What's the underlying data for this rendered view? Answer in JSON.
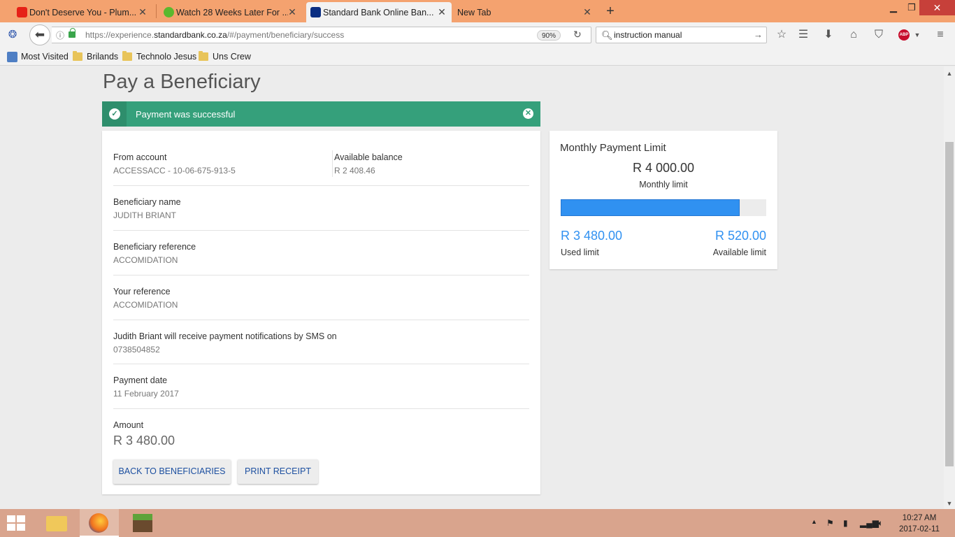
{
  "browser": {
    "tabs": [
      {
        "title": "Don't Deserve You - Plum...",
        "favicon": "youtube-icon",
        "color": "#e62117"
      },
      {
        "title": "Watch 28 Weeks Later For ...",
        "favicon": "play-icon",
        "color": "#5bb82e"
      },
      {
        "title": "Standard Bank Online Ban...",
        "favicon": "standard-bank-icon",
        "color": "#0a2e82"
      },
      {
        "title": "New Tab",
        "favicon": "",
        "color": ""
      }
    ],
    "url_prefix": "https://experience.",
    "url_domain": "standardbank.co.za",
    "url_suffix": "/#/payment/beneficiary/success",
    "zoom": "90%",
    "search_value": "instruction manual",
    "abp_label": "ABP",
    "bookmarks": [
      "Most Visited",
      "Brilands",
      "Technolo Jesus",
      "Uns Crew"
    ]
  },
  "page": {
    "title": "Pay a Beneficiary",
    "banner_text": "Payment was successful",
    "from_account_label": "From account",
    "from_account_value": "ACCESSACC - 10-06-675-913-5",
    "balance_label": "Available balance",
    "balance_value": "R 2 408.46",
    "beneficiary_name_label": "Beneficiary name",
    "beneficiary_name_value": "JUDITH BRIANT",
    "beneficiary_ref_label": "Beneficiary reference",
    "beneficiary_ref_value": "ACCOMIDATION",
    "your_ref_label": "Your reference",
    "your_ref_value": "ACCOMIDATION",
    "sms_label": "Judith Briant will receive payment notifications by SMS on",
    "sms_value": "0738504852",
    "date_label": "Payment date",
    "date_value": "11 February 2017",
    "amount_label": "Amount",
    "amount_value": "R 3 480.00",
    "back_button": "BACK TO BENEFICIARIES",
    "print_button": "PRINT RECEIPT"
  },
  "limit": {
    "title": "Monthly Payment Limit",
    "total": "R 4 000.00",
    "total_label": "Monthly limit",
    "used": "R 3 480.00",
    "used_label": "Used limit",
    "available": "R 520.00",
    "available_label": "Available limit",
    "used_fraction": 0.87
  },
  "taskbar": {
    "time": "10:27 AM",
    "date": "2017-02-11"
  },
  "colors": {
    "success": "#35a07b",
    "accent_blue": "#3091f1",
    "button_text": "#1c4fa0"
  }
}
